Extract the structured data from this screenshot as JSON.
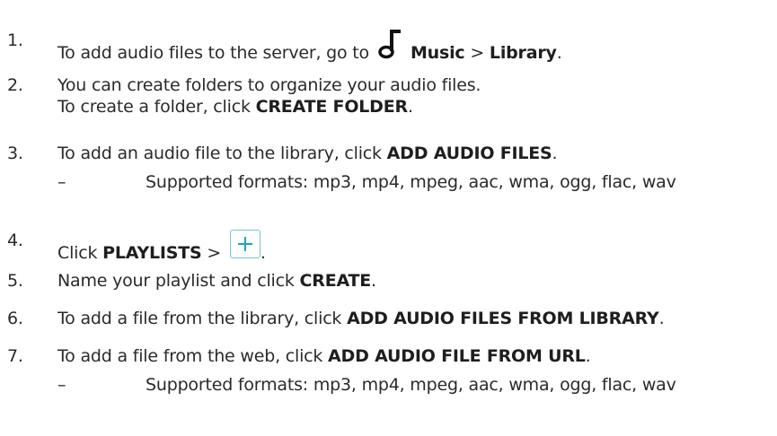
{
  "steps": [
    {
      "num": "1.",
      "before": "To add audio files to the server, go to",
      "icon": "music-note-icon",
      "bold1": "Music",
      "sep": " > ",
      "bold2": "Library",
      "after": "."
    },
    {
      "num": "2.",
      "line1": "You can create folders to organize your audio files.",
      "line2_before": "To create a folder, click ",
      "line2_bold": "CREATE FOLDER",
      "line2_after": "."
    },
    {
      "num": "3.",
      "before": "To add an audio file to the library, click ",
      "bold": "ADD AUDIO FILES",
      "after": ".",
      "sub_dash": "–",
      "sub_text": "Supported formats: mp3, mp4, mpeg, aac, wma, ogg, flac, wav"
    },
    {
      "num": "4.",
      "before": "Click ",
      "bold": "PLAYLISTS",
      "sep": " > ",
      "icon": "plus-icon",
      "after": "."
    },
    {
      "num": "5.",
      "before": "Name your playlist and click ",
      "bold": "CREATE",
      "after": "."
    },
    {
      "num": "6.",
      "before": "To add a file from the library, click ",
      "bold": "ADD AUDIO FILES FROM LIBRARY",
      "after": "."
    },
    {
      "num": "7.",
      "before": "To add a file from the web, click ",
      "bold": "ADD AUDIO FILE FROM URL",
      "after": ".",
      "sub_dash": "–",
      "sub_text": "Supported formats: mp3, mp4, mpeg, aac, wma, ogg, flac, wav"
    }
  ],
  "colors": {
    "text": "#2a2a2a",
    "plus_icon_accent": "#6fc6d3"
  }
}
